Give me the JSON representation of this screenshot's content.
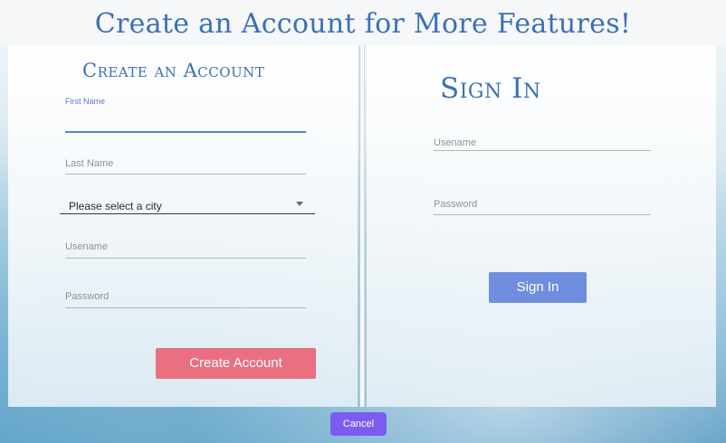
{
  "page": {
    "title": "Create an Account for More Features!"
  },
  "create_account": {
    "heading": "Create an Account",
    "first_name_label": "First Name",
    "last_name_label": "Last Name",
    "city_select": "Please select a city",
    "username_label": "Usename",
    "password_label": "Password",
    "submit_label": "Create Account"
  },
  "sign_in": {
    "heading": "Sign In",
    "username_label": "Usename",
    "password_label": "Password",
    "submit_label": "Sign In"
  },
  "footer": {
    "cancel_label": "Cancel"
  },
  "colors": {
    "title": "#3d6fb6",
    "create_button": "#ea6f80",
    "signin_button": "#6f8ee0",
    "cancel_button": "#7c5cf0",
    "active_field_underline": "#5f7bc8"
  },
  "icons": {
    "select_caret": "caret-down-icon"
  }
}
